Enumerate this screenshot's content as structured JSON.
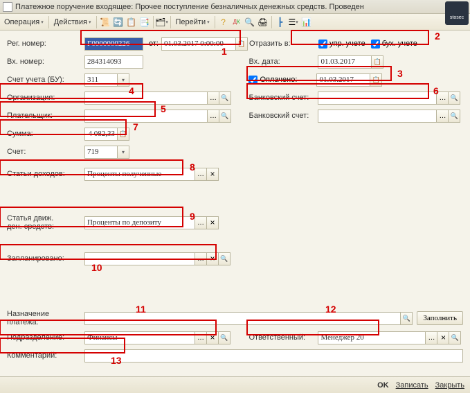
{
  "title": "Платежное поручение входящее: Прочее поступление безналичных денежных средств. Проведен",
  "logo_text": "stosec",
  "toolbar": {
    "operation": "Операция",
    "actions": "Действия",
    "go": "Перейти"
  },
  "labels": {
    "reg_num": "Рег. номер:",
    "from": "от:",
    "in_num": "Вх. номер:",
    "account_bu": "Счет учета (БУ):",
    "organization": "Организация:",
    "payer": "Плательщик:",
    "sum": "Сумма:",
    "account": "Счет:",
    "income_items": "Статьи доходов:",
    "movement_item_l1": "Статья движ.",
    "movement_item_l2": "ден. средств:",
    "planned": "Запланировано:",
    "payment_purpose_l1": "Назначение",
    "payment_purpose_l2": "платежа:",
    "department": "Подразделение:",
    "comment": "Комментарий:",
    "reflect_in": "Отразить в:",
    "mgmt_acct": "упр. учете",
    "acct_acct": "бух. учете",
    "in_date": "Вх. дата:",
    "paid": "Оплачено:",
    "bank_account": "Банковский счет:",
    "bank_account2": "Банковский счет:",
    "responsible": "Ответственный:"
  },
  "values": {
    "reg_num": "Г0000000226",
    "from_date": "01.03.2017 0:00:00",
    "in_num": "284314093",
    "account_bu": "311",
    "organization": "",
    "payer": "",
    "sum": "4 082,33",
    "account": "719",
    "income_items": "Проценты полученные",
    "movement_item": "Проценты по депозиту",
    "planned": "",
    "payment_purpose": "",
    "department": "Финансы",
    "comment": "",
    "in_date": "01.03.2017",
    "paid_date": "01.03.2017",
    "bank_account": "",
    "bank_account2": "",
    "responsible": "Менеджер 20"
  },
  "buttons": {
    "fill": "Заполнить",
    "ok": "OK",
    "save": "Записать",
    "close": "Закрыть"
  },
  "annotations": {
    "n1": "1",
    "n2": "2",
    "n3": "3",
    "n4": "4",
    "n5": "5",
    "n6": "6",
    "n7": "7",
    "n8": "8",
    "n9": "9",
    "n10": "10",
    "n11": "11",
    "n12": "12",
    "n13": "13"
  }
}
